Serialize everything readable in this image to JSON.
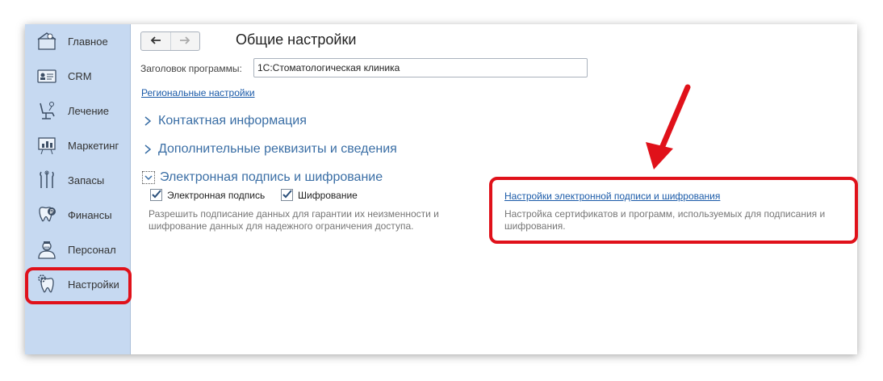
{
  "sidebar": {
    "items": [
      {
        "label": "Главное",
        "icon": "tooth-home-icon"
      },
      {
        "label": "CRM",
        "icon": "id-card-icon"
      },
      {
        "label": "Лечение",
        "icon": "dental-chair-icon"
      },
      {
        "label": "Маркетинг",
        "icon": "presentation-chart-icon"
      },
      {
        "label": "Запасы",
        "icon": "dental-tools-icon"
      },
      {
        "label": "Финансы",
        "icon": "tooth-coin-icon"
      },
      {
        "label": "Персонал",
        "icon": "doctor-icon"
      },
      {
        "label": "Настройки",
        "icon": "tooth-gear-icon",
        "highlighted": true
      }
    ]
  },
  "header": {
    "back_icon": "arrow-left-icon",
    "forward_icon": "arrow-right-icon",
    "title": "Общие настройки"
  },
  "form": {
    "program_title_label": "Заголовок программы:",
    "program_title_value": "1С:Стоматологическая клиника",
    "regional_link": "Региональные настройки"
  },
  "groups": {
    "contact": "Контактная информация",
    "additional": "Дополнительные реквизиты и сведения",
    "signature": "Электронная подпись и шифрование"
  },
  "signature": {
    "checkbox_signature_label": "Электронная подпись",
    "checkbox_signature_checked": true,
    "checkbox_encryption_label": "Шифрование",
    "checkbox_encryption_checked": true,
    "description": "Разрешить подписание данных для гарантии их неизменности и шифрование данных для надежного ограничения доступа.",
    "settings_link": "Настройки электронной подписи и шифрования",
    "settings_description": "Настройка сертификатов и программ, используемых для подписания и шифрования."
  },
  "colors": {
    "sidebar_bg": "#c6d9f1",
    "accent_blue": "#3a6ea5",
    "link_blue": "#1a5aa8",
    "highlight_red": "#e0111a"
  }
}
